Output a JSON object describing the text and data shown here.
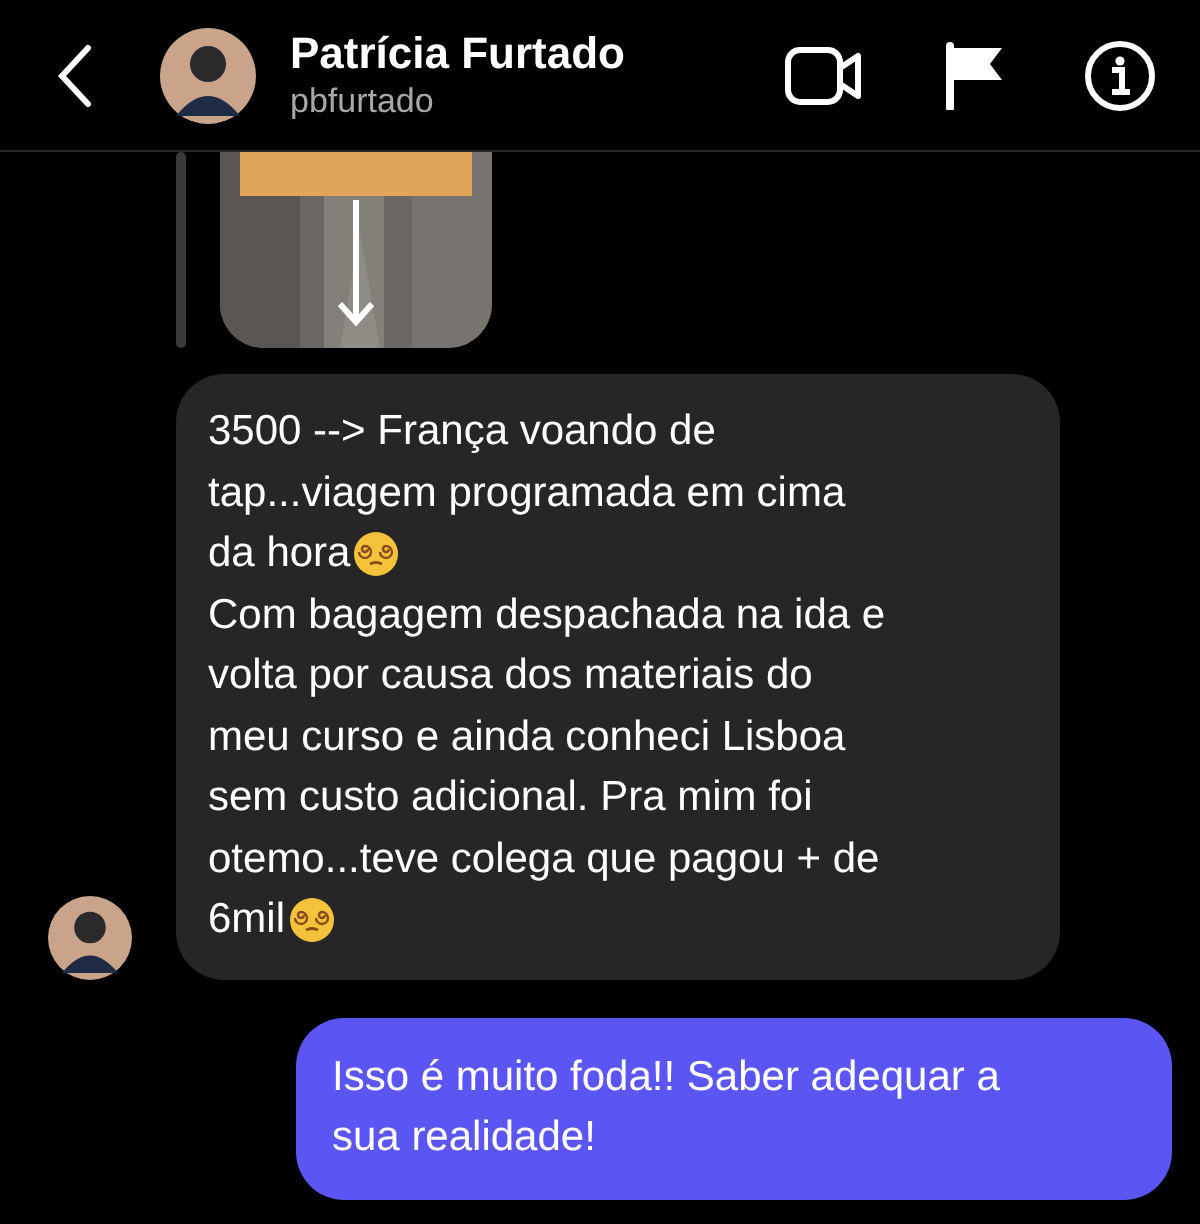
{
  "header": {
    "name": "Patrícia Furtado",
    "username": "pbfurtado"
  },
  "messages": [
    {
      "kind": "story_reply"
    },
    {
      "kind": "text",
      "outgoing": false,
      "show_avatar": true,
      "lines": [
        {
          "text": "3500 --> França voando de",
          "emoji": false
        },
        {
          "text": "tap...viagem programada em cima",
          "emoji": false
        },
        {
          "text": "da hora",
          "emoji": true
        },
        {
          "text": "Com bagagem despachada na ida e",
          "emoji": false
        },
        {
          "text": "volta por causa dos materiais do",
          "emoji": false
        },
        {
          "text": "meu curso e ainda conheci Lisboa",
          "emoji": false
        },
        {
          "text": "sem custo adicional. Pra mim foi",
          "emoji": false
        },
        {
          "text": "otemo...teve colega que pagou + de",
          "emoji": false
        },
        {
          "text": "6mil",
          "emoji": true
        }
      ]
    },
    {
      "kind": "text",
      "outgoing": true,
      "lines": [
        {
          "text": "Isso é muito foda!! Saber adequar a",
          "emoji": false
        },
        {
          "text": "sua realidade!",
          "emoji": false
        }
      ]
    }
  ]
}
